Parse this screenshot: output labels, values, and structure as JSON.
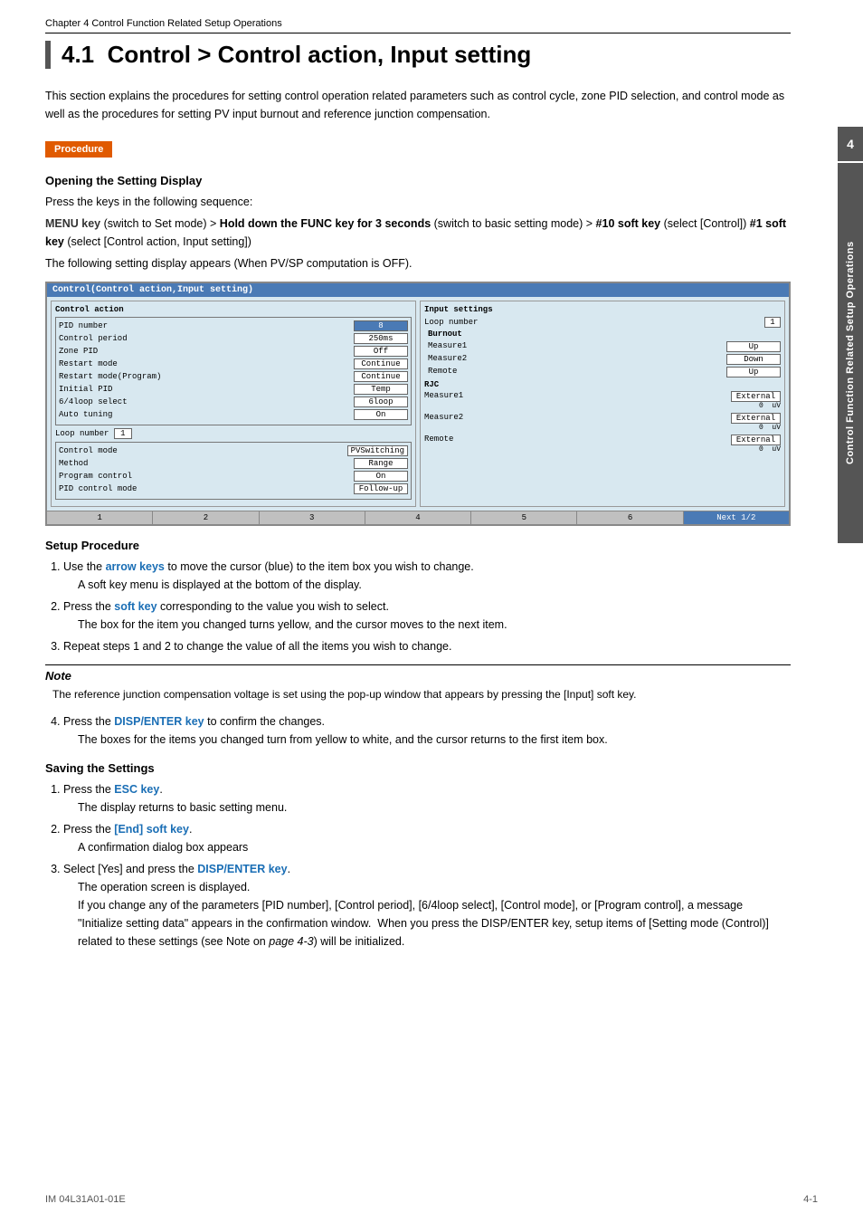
{
  "chapter": {
    "label": "Chapter 4   Control Function Related Setup Operations"
  },
  "section": {
    "number": "4.1",
    "title": "Control > Control action, Input setting"
  },
  "intro": {
    "text": "This section explains the procedures for setting control operation related parameters such as control cycle, zone PID selection, and control mode as well as the procedures for setting PV input burnout and reference junction compensation."
  },
  "procedure_badge": "Procedure",
  "opening_display": {
    "heading": "Opening the Setting Display",
    "line1": "Press the keys in the following sequence:",
    "sequence": {
      "menu_key": "MENU key",
      "menu_desc": " (switch to Set mode) > ",
      "hold_func": "Hold down the FUNC key for 3 seconds",
      "hold_desc": " (switch to basic setting mode) > ",
      "soft10": "#10 soft key",
      "soft10_desc": " (select [Control]) ",
      "soft1": "#1 soft key",
      "soft1_desc": " (select [Control action, Input setting])"
    },
    "display_caption": "The following setting display appears (When PV/SP computation is OFF)."
  },
  "display_screen": {
    "title": "Control(Control action,Input setting)",
    "left_panel": {
      "title": "Control action",
      "rows": [
        {
          "label": "PID number",
          "value": "8"
        },
        {
          "label": "Control period",
          "value": "250ms"
        },
        {
          "label": "Zone PID",
          "value": "Off"
        },
        {
          "label": "Restart mode",
          "value": "Continue"
        },
        {
          "label": "Restart mode(Program)",
          "value": "Continue"
        },
        {
          "label": "Initial PID",
          "value": "Temp"
        },
        {
          "label": "6/4loop select",
          "value": "6loop"
        },
        {
          "label": "Auto tuning",
          "value": "On"
        }
      ],
      "loop_number": "1",
      "bottom_rows": [
        {
          "label": "Control mode",
          "value": "PVSwitching"
        },
        {
          "label": "Method",
          "value": "Range"
        },
        {
          "label": "Program control",
          "value": "On"
        },
        {
          "label": "PID control mode",
          "value": "Follow-up"
        }
      ]
    },
    "right_panel": {
      "title": "Input settings",
      "loop_number": "1",
      "burnout_title": "Burnout",
      "burnout_rows": [
        {
          "label": "Measure1",
          "value": "Up"
        },
        {
          "label": "Measure2",
          "value": "Down"
        },
        {
          "label": "Remote",
          "value": "Up"
        }
      ],
      "rjc_title": "RJC",
      "rjc_rows": [
        {
          "label": "Measure1",
          "value1": "External",
          "value2": "0",
          "unit": "uV"
        },
        {
          "label": "Measure2",
          "value1": "External",
          "value2": "0",
          "unit": "uV"
        },
        {
          "label": "Remote",
          "value1": "External",
          "value2": "0",
          "unit": "uV"
        }
      ]
    },
    "footer": [
      "1",
      "2",
      "3",
      "4",
      "5",
      "6",
      "Next 1/2"
    ]
  },
  "setup_procedure": {
    "heading": "Setup Procedure",
    "steps": [
      {
        "num": "1.",
        "main": "Use the arrow keys to move the cursor (blue) to the item box you wish to change.",
        "sub": "A soft key menu is displayed at the bottom of the display.",
        "arrow_label": "arrow keys"
      },
      {
        "num": "2.",
        "main": "Press the soft key corresponding to the value you wish to select.",
        "sub": "The box for the item you changed turns yellow, and the cursor moves to the next item.",
        "soft_label": "soft key"
      },
      {
        "num": "3.",
        "main": "Repeat steps 1 and 2 to change the value of all the items you wish to change."
      }
    ]
  },
  "note": {
    "title": "Note",
    "text": "The reference junction compensation voltage is set using the pop-up window that appears by pressing the [Input] soft key."
  },
  "step4": {
    "num": "4.",
    "main": "Press the DISP/ENTER key to confirm the changes.",
    "sub": "The boxes for the items you changed turn from yellow to white, and the cursor returns to the first item box.",
    "disp_label": "DISP/ENTER key"
  },
  "saving": {
    "heading": "Saving the Settings",
    "steps": [
      {
        "num": "1.",
        "main": "Press the ESC key.",
        "sub": "The display returns to basic setting menu.",
        "esc_label": "ESC key"
      },
      {
        "num": "2.",
        "main": "Press the [End] soft key.",
        "sub": "A confirmation dialog box appears",
        "end_label": "[End] soft key"
      },
      {
        "num": "3.",
        "main": "Select [Yes] and press the DISP/ENTER key.",
        "subs": [
          "The operation screen is displayed.",
          "If you change any of the parameters [PID number], [Control period], [6/4loop select], [Control mode], or [Program control], a message \"Initialize setting data\" appears in the confirmation window.  When you press the DISP/ENTER key, setup items of [Setting mode (Control)] related to these settings (see Note on page 4-3) will be initialized."
        ],
        "disp_label": "DISP/ENTER key"
      }
    ]
  },
  "side_tab": {
    "number": "4",
    "text": "Control Function Related Setup Operations"
  },
  "footer": {
    "left": "IM 04L31A01-01E",
    "right": "4-1"
  }
}
